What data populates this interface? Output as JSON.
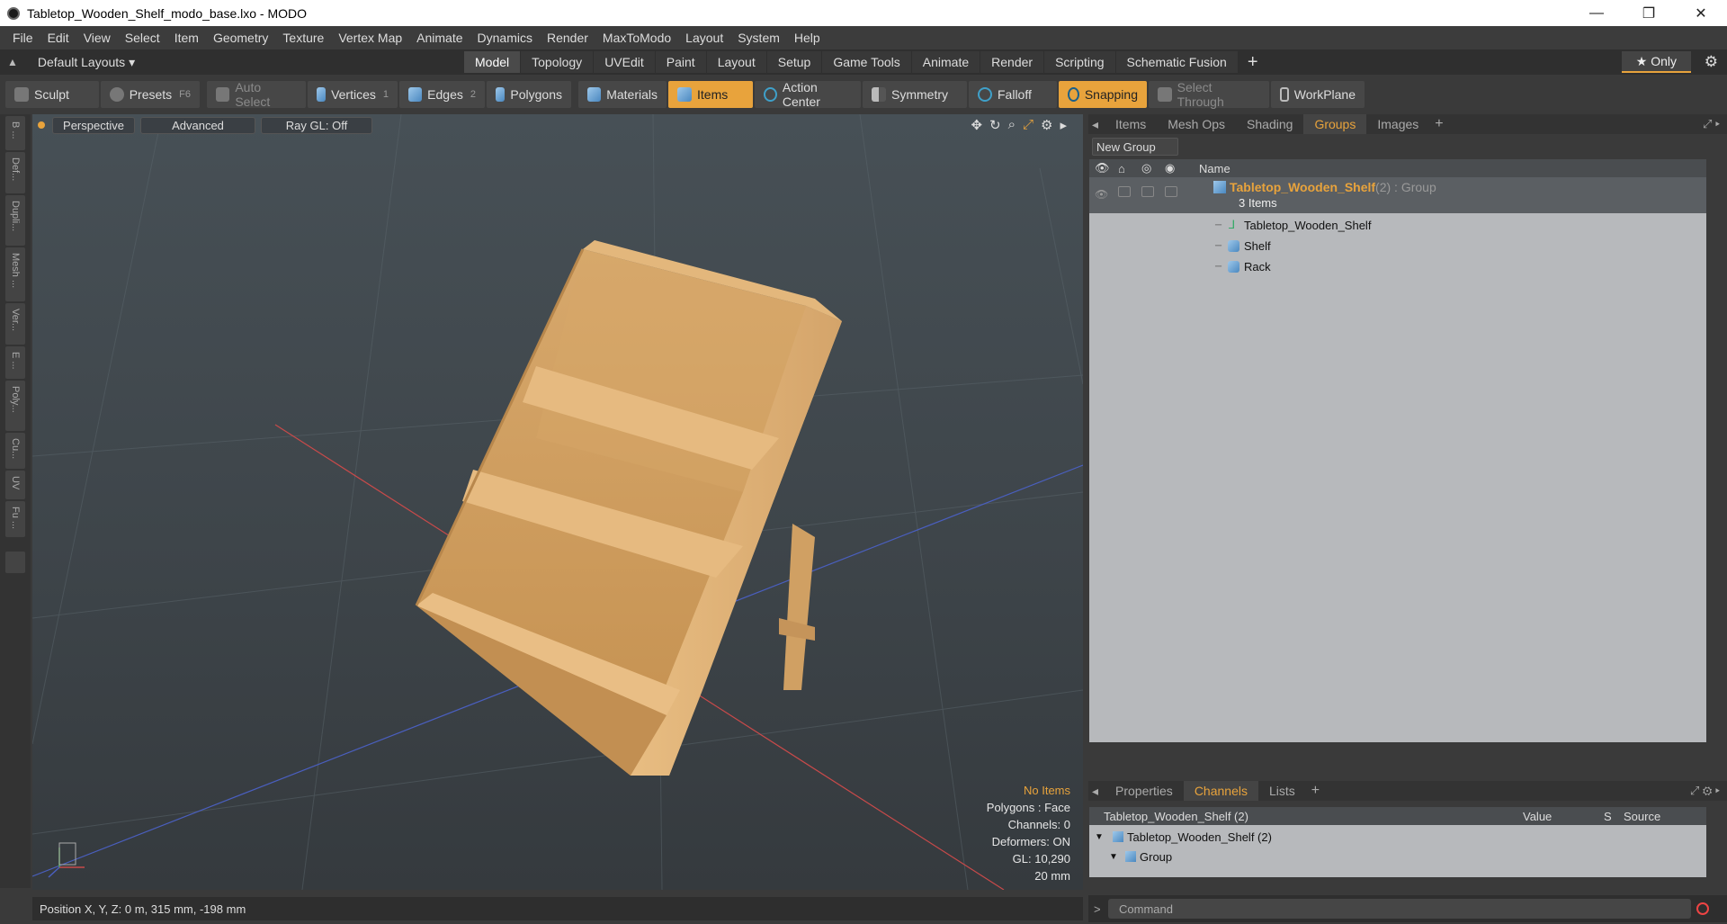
{
  "window": {
    "title": "Tabletop_Wooden_Shelf_modo_base.lxo - MODO",
    "min": "—",
    "max": "❐",
    "close": "✕"
  },
  "menu": [
    "File",
    "Edit",
    "View",
    "Select",
    "Item",
    "Geometry",
    "Texture",
    "Vertex Map",
    "Animate",
    "Dynamics",
    "Render",
    "MaxToModo",
    "Layout",
    "System",
    "Help"
  ],
  "layouts": {
    "label": "Default Layouts ▾"
  },
  "mode_tabs": [
    "Model",
    "Topology",
    "UVEdit",
    "Paint",
    "Layout",
    "Setup",
    "Game Tools",
    "Animate",
    "Render",
    "Scripting",
    "Schematic Fusion"
  ],
  "only_label": "★  Only",
  "toolbar": {
    "sculpt": "Sculpt",
    "presets": "Presets",
    "presets_key": "F6",
    "auto_select": "Auto Select",
    "vertices": "Vertices",
    "vertices_n": "1",
    "edges": "Edges",
    "edges_n": "2",
    "polygons": "Polygons",
    "materials": "Materials",
    "items": "Items",
    "action_center": "Action Center",
    "symmetry": "Symmetry",
    "falloff": "Falloff",
    "snapping": "Snapping",
    "select_through": "Select Through",
    "workplane": "WorkPlane"
  },
  "left_tabs": [
    "B ...",
    "Def...",
    "Dupli...",
    "Mesh ...",
    "Ver...",
    "E ...",
    "Poly...",
    "Cu...",
    "UV",
    "Fu ..."
  ],
  "viewport": {
    "perspective": "Perspective",
    "advanced": "Advanced",
    "raygl": "Ray GL: Off"
  },
  "stats": {
    "items": "No Items",
    "polygons": "Polygons : Face",
    "channels": "Channels: 0",
    "deformers": "Deformers: ON",
    "gl": "GL: 10,290",
    "scale": "20 mm"
  },
  "status": {
    "position": "Position X, Y, Z:   0 m, 315 mm, -198 mm"
  },
  "top_tabs": [
    "Items",
    "Mesh Ops",
    "Shading",
    "Groups",
    "Images"
  ],
  "groups": {
    "new_group": "New Group",
    "name_col": "Name",
    "group_name": "Tabletop_Wooden_Shelf",
    "group_suffix": " (2) : Group",
    "count": "3 Items",
    "children": [
      "Tabletop_Wooden_Shelf",
      "Shelf",
      "Rack"
    ]
  },
  "bottom_tabs": [
    "Properties",
    "Channels",
    "Lists"
  ],
  "channels": {
    "header": "Tabletop_Wooden_Shelf (2)",
    "value_col": "Value",
    "s_col": "S",
    "source_col": "Source",
    "row1": "Tabletop_Wooden_Shelf (2)",
    "row2": "Group"
  },
  "command": {
    "placeholder": "Command"
  }
}
